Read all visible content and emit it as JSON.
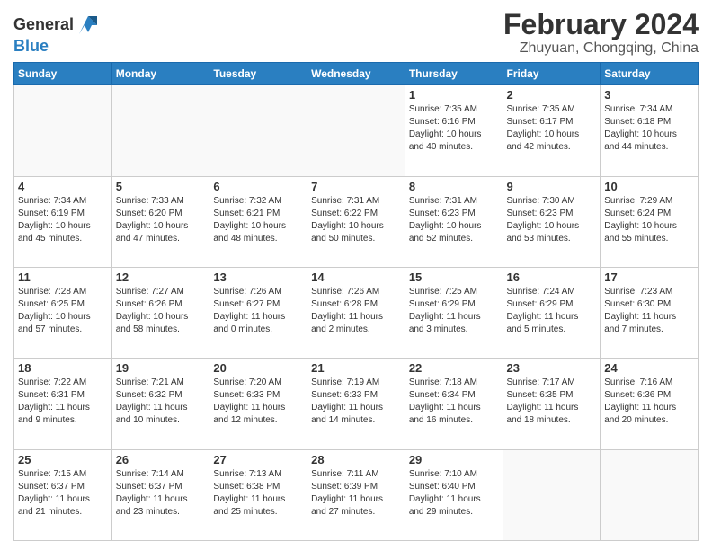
{
  "logo": {
    "line1": "General",
    "line2": "Blue"
  },
  "header": {
    "title": "February 2024",
    "subtitle": "Zhuyuan, Chongqing, China"
  },
  "weekdays": [
    "Sunday",
    "Monday",
    "Tuesday",
    "Wednesday",
    "Thursday",
    "Friday",
    "Saturday"
  ],
  "weeks": [
    [
      {
        "day": "",
        "info": ""
      },
      {
        "day": "",
        "info": ""
      },
      {
        "day": "",
        "info": ""
      },
      {
        "day": "",
        "info": ""
      },
      {
        "day": "1",
        "info": "Sunrise: 7:35 AM\nSunset: 6:16 PM\nDaylight: 10 hours\nand 40 minutes."
      },
      {
        "day": "2",
        "info": "Sunrise: 7:35 AM\nSunset: 6:17 PM\nDaylight: 10 hours\nand 42 minutes."
      },
      {
        "day": "3",
        "info": "Sunrise: 7:34 AM\nSunset: 6:18 PM\nDaylight: 10 hours\nand 44 minutes."
      }
    ],
    [
      {
        "day": "4",
        "info": "Sunrise: 7:34 AM\nSunset: 6:19 PM\nDaylight: 10 hours\nand 45 minutes."
      },
      {
        "day": "5",
        "info": "Sunrise: 7:33 AM\nSunset: 6:20 PM\nDaylight: 10 hours\nand 47 minutes."
      },
      {
        "day": "6",
        "info": "Sunrise: 7:32 AM\nSunset: 6:21 PM\nDaylight: 10 hours\nand 48 minutes."
      },
      {
        "day": "7",
        "info": "Sunrise: 7:31 AM\nSunset: 6:22 PM\nDaylight: 10 hours\nand 50 minutes."
      },
      {
        "day": "8",
        "info": "Sunrise: 7:31 AM\nSunset: 6:23 PM\nDaylight: 10 hours\nand 52 minutes."
      },
      {
        "day": "9",
        "info": "Sunrise: 7:30 AM\nSunset: 6:23 PM\nDaylight: 10 hours\nand 53 minutes."
      },
      {
        "day": "10",
        "info": "Sunrise: 7:29 AM\nSunset: 6:24 PM\nDaylight: 10 hours\nand 55 minutes."
      }
    ],
    [
      {
        "day": "11",
        "info": "Sunrise: 7:28 AM\nSunset: 6:25 PM\nDaylight: 10 hours\nand 57 minutes."
      },
      {
        "day": "12",
        "info": "Sunrise: 7:27 AM\nSunset: 6:26 PM\nDaylight: 10 hours\nand 58 minutes."
      },
      {
        "day": "13",
        "info": "Sunrise: 7:26 AM\nSunset: 6:27 PM\nDaylight: 11 hours\nand 0 minutes."
      },
      {
        "day": "14",
        "info": "Sunrise: 7:26 AM\nSunset: 6:28 PM\nDaylight: 11 hours\nand 2 minutes."
      },
      {
        "day": "15",
        "info": "Sunrise: 7:25 AM\nSunset: 6:29 PM\nDaylight: 11 hours\nand 3 minutes."
      },
      {
        "day": "16",
        "info": "Sunrise: 7:24 AM\nSunset: 6:29 PM\nDaylight: 11 hours\nand 5 minutes."
      },
      {
        "day": "17",
        "info": "Sunrise: 7:23 AM\nSunset: 6:30 PM\nDaylight: 11 hours\nand 7 minutes."
      }
    ],
    [
      {
        "day": "18",
        "info": "Sunrise: 7:22 AM\nSunset: 6:31 PM\nDaylight: 11 hours\nand 9 minutes."
      },
      {
        "day": "19",
        "info": "Sunrise: 7:21 AM\nSunset: 6:32 PM\nDaylight: 11 hours\nand 10 minutes."
      },
      {
        "day": "20",
        "info": "Sunrise: 7:20 AM\nSunset: 6:33 PM\nDaylight: 11 hours\nand 12 minutes."
      },
      {
        "day": "21",
        "info": "Sunrise: 7:19 AM\nSunset: 6:33 PM\nDaylight: 11 hours\nand 14 minutes."
      },
      {
        "day": "22",
        "info": "Sunrise: 7:18 AM\nSunset: 6:34 PM\nDaylight: 11 hours\nand 16 minutes."
      },
      {
        "day": "23",
        "info": "Sunrise: 7:17 AM\nSunset: 6:35 PM\nDaylight: 11 hours\nand 18 minutes."
      },
      {
        "day": "24",
        "info": "Sunrise: 7:16 AM\nSunset: 6:36 PM\nDaylight: 11 hours\nand 20 minutes."
      }
    ],
    [
      {
        "day": "25",
        "info": "Sunrise: 7:15 AM\nSunset: 6:37 PM\nDaylight: 11 hours\nand 21 minutes."
      },
      {
        "day": "26",
        "info": "Sunrise: 7:14 AM\nSunset: 6:37 PM\nDaylight: 11 hours\nand 23 minutes."
      },
      {
        "day": "27",
        "info": "Sunrise: 7:13 AM\nSunset: 6:38 PM\nDaylight: 11 hours\nand 25 minutes."
      },
      {
        "day": "28",
        "info": "Sunrise: 7:11 AM\nSunset: 6:39 PM\nDaylight: 11 hours\nand 27 minutes."
      },
      {
        "day": "29",
        "info": "Sunrise: 7:10 AM\nSunset: 6:40 PM\nDaylight: 11 hours\nand 29 minutes."
      },
      {
        "day": "",
        "info": ""
      },
      {
        "day": "",
        "info": ""
      }
    ]
  ]
}
